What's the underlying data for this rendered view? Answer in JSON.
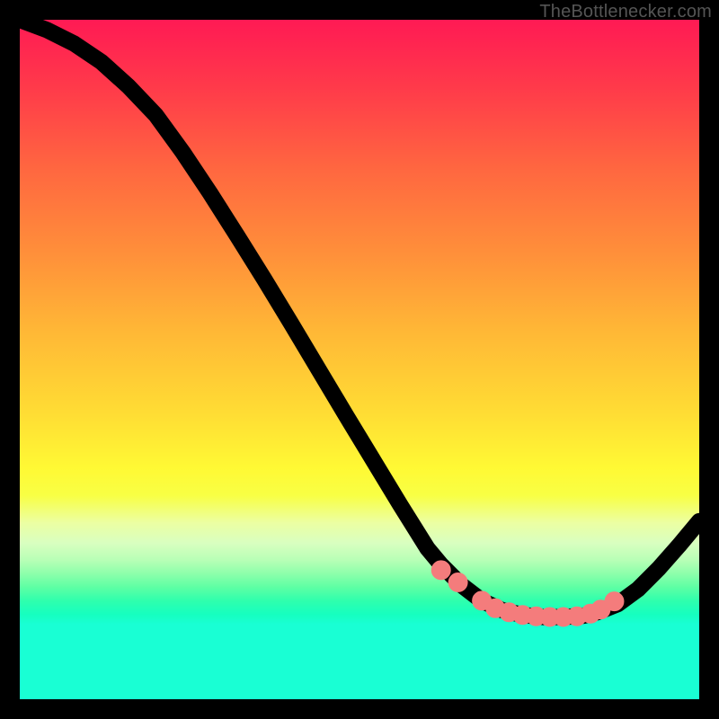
{
  "source_label": "TheBottlenecker.com",
  "gradient_colors": {
    "top": "#ff1a54",
    "mid_warm": "#ffdd34",
    "yellow": "#fff934",
    "green_start": "#b8ffb6",
    "green_deep": "#19ffd4"
  },
  "chart_data": {
    "type": "line",
    "title": "",
    "xlabel": "",
    "ylabel": "",
    "xlim": [
      0,
      100
    ],
    "ylim": [
      0,
      100
    ],
    "note": "Axes are unlabeled; values are estimated positions within plot (0..100). Curve depicts a bottleneck-mismatch style V-shape with a flat minimum around x≈70-85.",
    "series": [
      {
        "name": "curve",
        "x": [
          0,
          4,
          8,
          12,
          16,
          20,
          24,
          28,
          32,
          36,
          40,
          44,
          48,
          52,
          56,
          60,
          62,
          65,
          68,
          71,
          74,
          77,
          80,
          83,
          85,
          88,
          91,
          94,
          97,
          100
        ],
        "y": [
          100,
          98.5,
          96.5,
          93.8,
          90.2,
          86.0,
          80.5,
          74.5,
          68.2,
          61.8,
          55.2,
          48.5,
          41.8,
          35.2,
          28.6,
          22.2,
          19.8,
          16.8,
          14.5,
          13.1,
          12.4,
          12.1,
          12.1,
          12.3,
          12.8,
          14.0,
          16.2,
          19.2,
          22.6,
          26.2
        ]
      }
    ],
    "markers": {
      "name": "flat-region-dots",
      "x": [
        62,
        64.5,
        68,
        70,
        72,
        74,
        76,
        78,
        80,
        82,
        84,
        85.5,
        87.5
      ],
      "y": [
        19.0,
        17.2,
        14.5,
        13.4,
        12.8,
        12.4,
        12.2,
        12.1,
        12.1,
        12.2,
        12.6,
        13.2,
        14.4
      ]
    }
  }
}
